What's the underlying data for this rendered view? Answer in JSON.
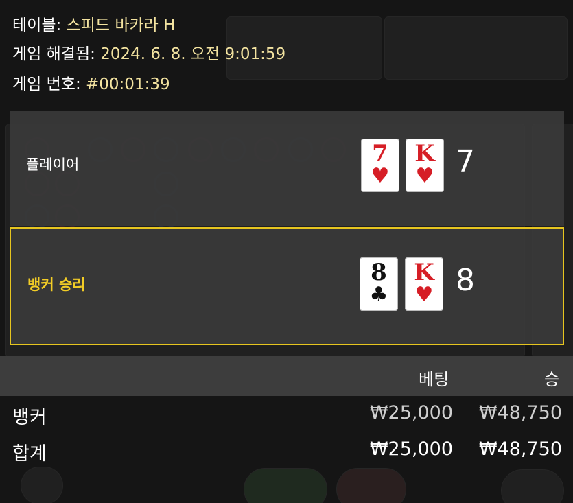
{
  "header": {
    "table_label": "테이블:",
    "table_value": "스피드 바카라 H",
    "resolved_label": "게임 해결됨:",
    "resolved_value": "2024. 6. 8. 오전 9:01:59",
    "number_label": "게임 번호:",
    "number_value": "#00:01:39"
  },
  "player": {
    "label": "플레이어",
    "cards": [
      {
        "rank": "7",
        "suit": "♥",
        "color": "#d61e26"
      },
      {
        "rank": "K",
        "suit": "♥",
        "color": "#d61e26"
      }
    ],
    "score": "7"
  },
  "banker": {
    "label": "뱅커 승리",
    "cards": [
      {
        "rank": "8",
        "suit": "♣",
        "color": "#111111"
      },
      {
        "rank": "K",
        "suit": "♥",
        "color": "#d61e26"
      }
    ],
    "score": "8",
    "highlight_color": "#e6c51f"
  },
  "bets_table": {
    "headers": {
      "bet": "베팅",
      "win": "승"
    },
    "rows": [
      {
        "name": "뱅커",
        "bet": "₩25,000",
        "win": "₩48,750"
      }
    ],
    "total": {
      "name": "합계",
      "bet": "₩25,000",
      "win": "₩48,750"
    }
  }
}
